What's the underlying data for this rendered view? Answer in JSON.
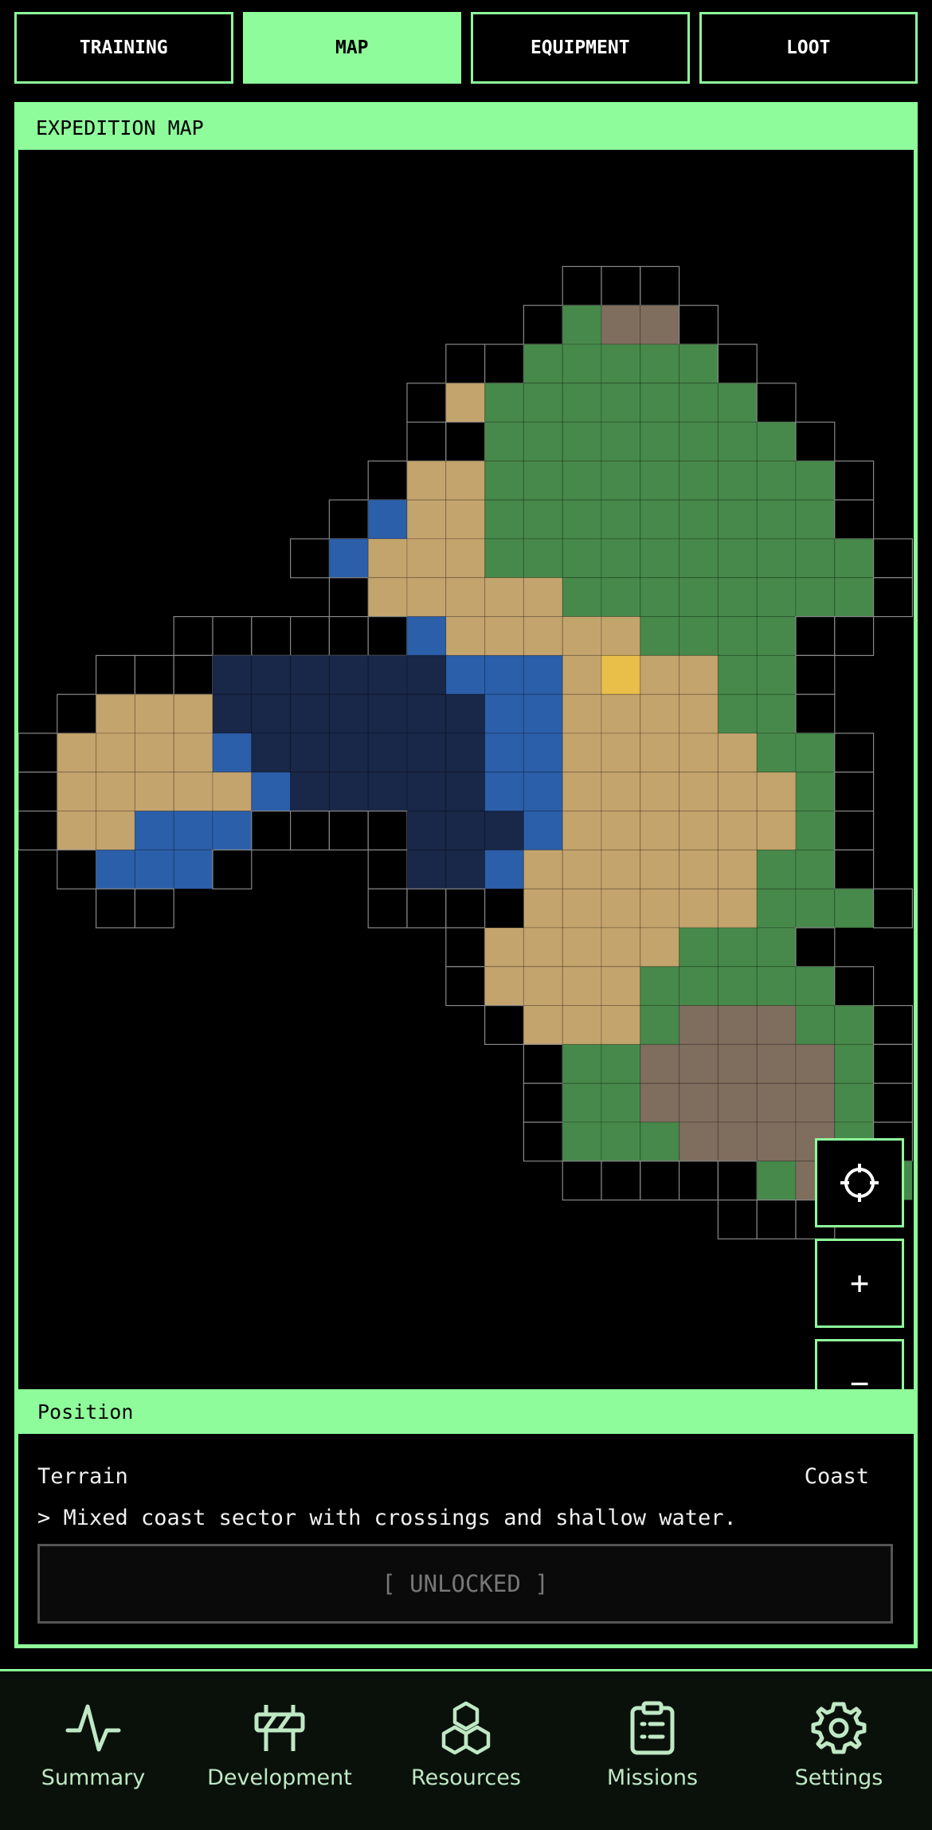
{
  "tabs": [
    {
      "label": "TRAINING",
      "active": false
    },
    {
      "label": "MAP",
      "active": true
    },
    {
      "label": "EQUIPMENT",
      "active": false
    },
    {
      "label": "LOOT",
      "active": false
    }
  ],
  "map": {
    "title": "EXPEDITION MAP",
    "controls": {
      "center_icon": "crosshair-icon",
      "zoom_in": "+",
      "zoom_out": "−"
    },
    "terrain_colors": {
      "grassland": "#47894b",
      "sand": "#c4a46d",
      "shallow_water": "#2c5faa",
      "deep_water": "#192748",
      "mountain": "#7f6d5e",
      "selected": "#e9bf4a",
      "fog_border": "#888888"
    }
  },
  "position": {
    "title": "Position",
    "terrain_label": "Terrain",
    "terrain_value": "Coast",
    "description": "> Mixed coast sector with crossings and shallow water.",
    "status": "[ UNLOCKED ]"
  },
  "bottom_nav": [
    {
      "label": "Summary",
      "icon": "pulse-icon"
    },
    {
      "label": "Development",
      "icon": "barrier-icon"
    },
    {
      "label": "Resources",
      "icon": "cubes-icon"
    },
    {
      "label": "Missions",
      "icon": "clipboard-icon"
    },
    {
      "label": "Settings",
      "icon": "gear-icon"
    }
  ]
}
